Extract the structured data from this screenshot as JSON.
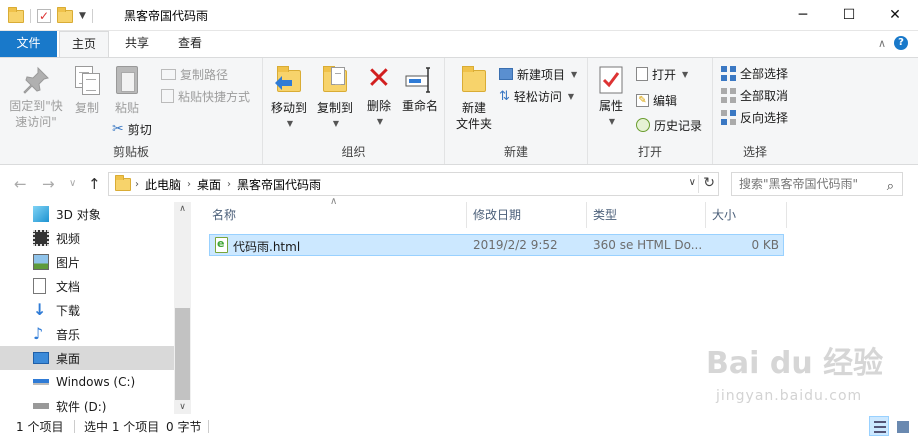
{
  "window": {
    "title": "黑客帝国代码雨",
    "minimize": "─",
    "maximize": "☐",
    "close": "✕"
  },
  "tabs": {
    "file": "文件",
    "home": "主页",
    "share": "共享",
    "view": "查看"
  },
  "ribbon": {
    "clipboard": {
      "label": "剪贴板",
      "pin": "固定到\"快",
      "pin2": "速访问\"",
      "copy": "复制",
      "paste": "粘贴",
      "copy_path": "复制路径",
      "paste_shortcut": "粘贴快捷方式",
      "cut": "剪切"
    },
    "organize": {
      "label": "组织",
      "move_to": "移动到",
      "copy_to": "复制到",
      "delete": "删除",
      "rename": "重命名"
    },
    "new": {
      "label": "新建",
      "new_folder": "新建",
      "new_folder2": "文件夹",
      "new_item": "新建项目",
      "easy_access": "轻松访问"
    },
    "open": {
      "label": "打开",
      "properties": "属性",
      "open": "打开",
      "edit": "编辑",
      "history": "历史记录"
    },
    "select": {
      "label": "选择",
      "select_all": "全部选择",
      "select_none": "全部取消",
      "invert": "反向选择"
    }
  },
  "address": {
    "crumbs": [
      "此电脑",
      "桌面",
      "黑客帝国代码雨"
    ],
    "search_placeholder": "搜索\"黑客帝国代码雨\""
  },
  "nav": {
    "items": [
      "3D 对象",
      "视频",
      "图片",
      "文档",
      "下载",
      "音乐",
      "桌面",
      "Windows (C:)",
      "软件 (D:)"
    ]
  },
  "columns": {
    "name": "名称",
    "date": "修改日期",
    "type": "类型",
    "size": "大小"
  },
  "files": [
    {
      "name": "代码雨.html",
      "date": "2019/2/2 9:52",
      "type": "360 se HTML Do...",
      "size": "0 KB"
    }
  ],
  "status": {
    "count": "1 个项目",
    "selected": "选中 1 个项目",
    "bytes": "0 字节"
  },
  "watermark": {
    "main": "Bai du 经验",
    "sub": "jingyan.baidu.com"
  }
}
